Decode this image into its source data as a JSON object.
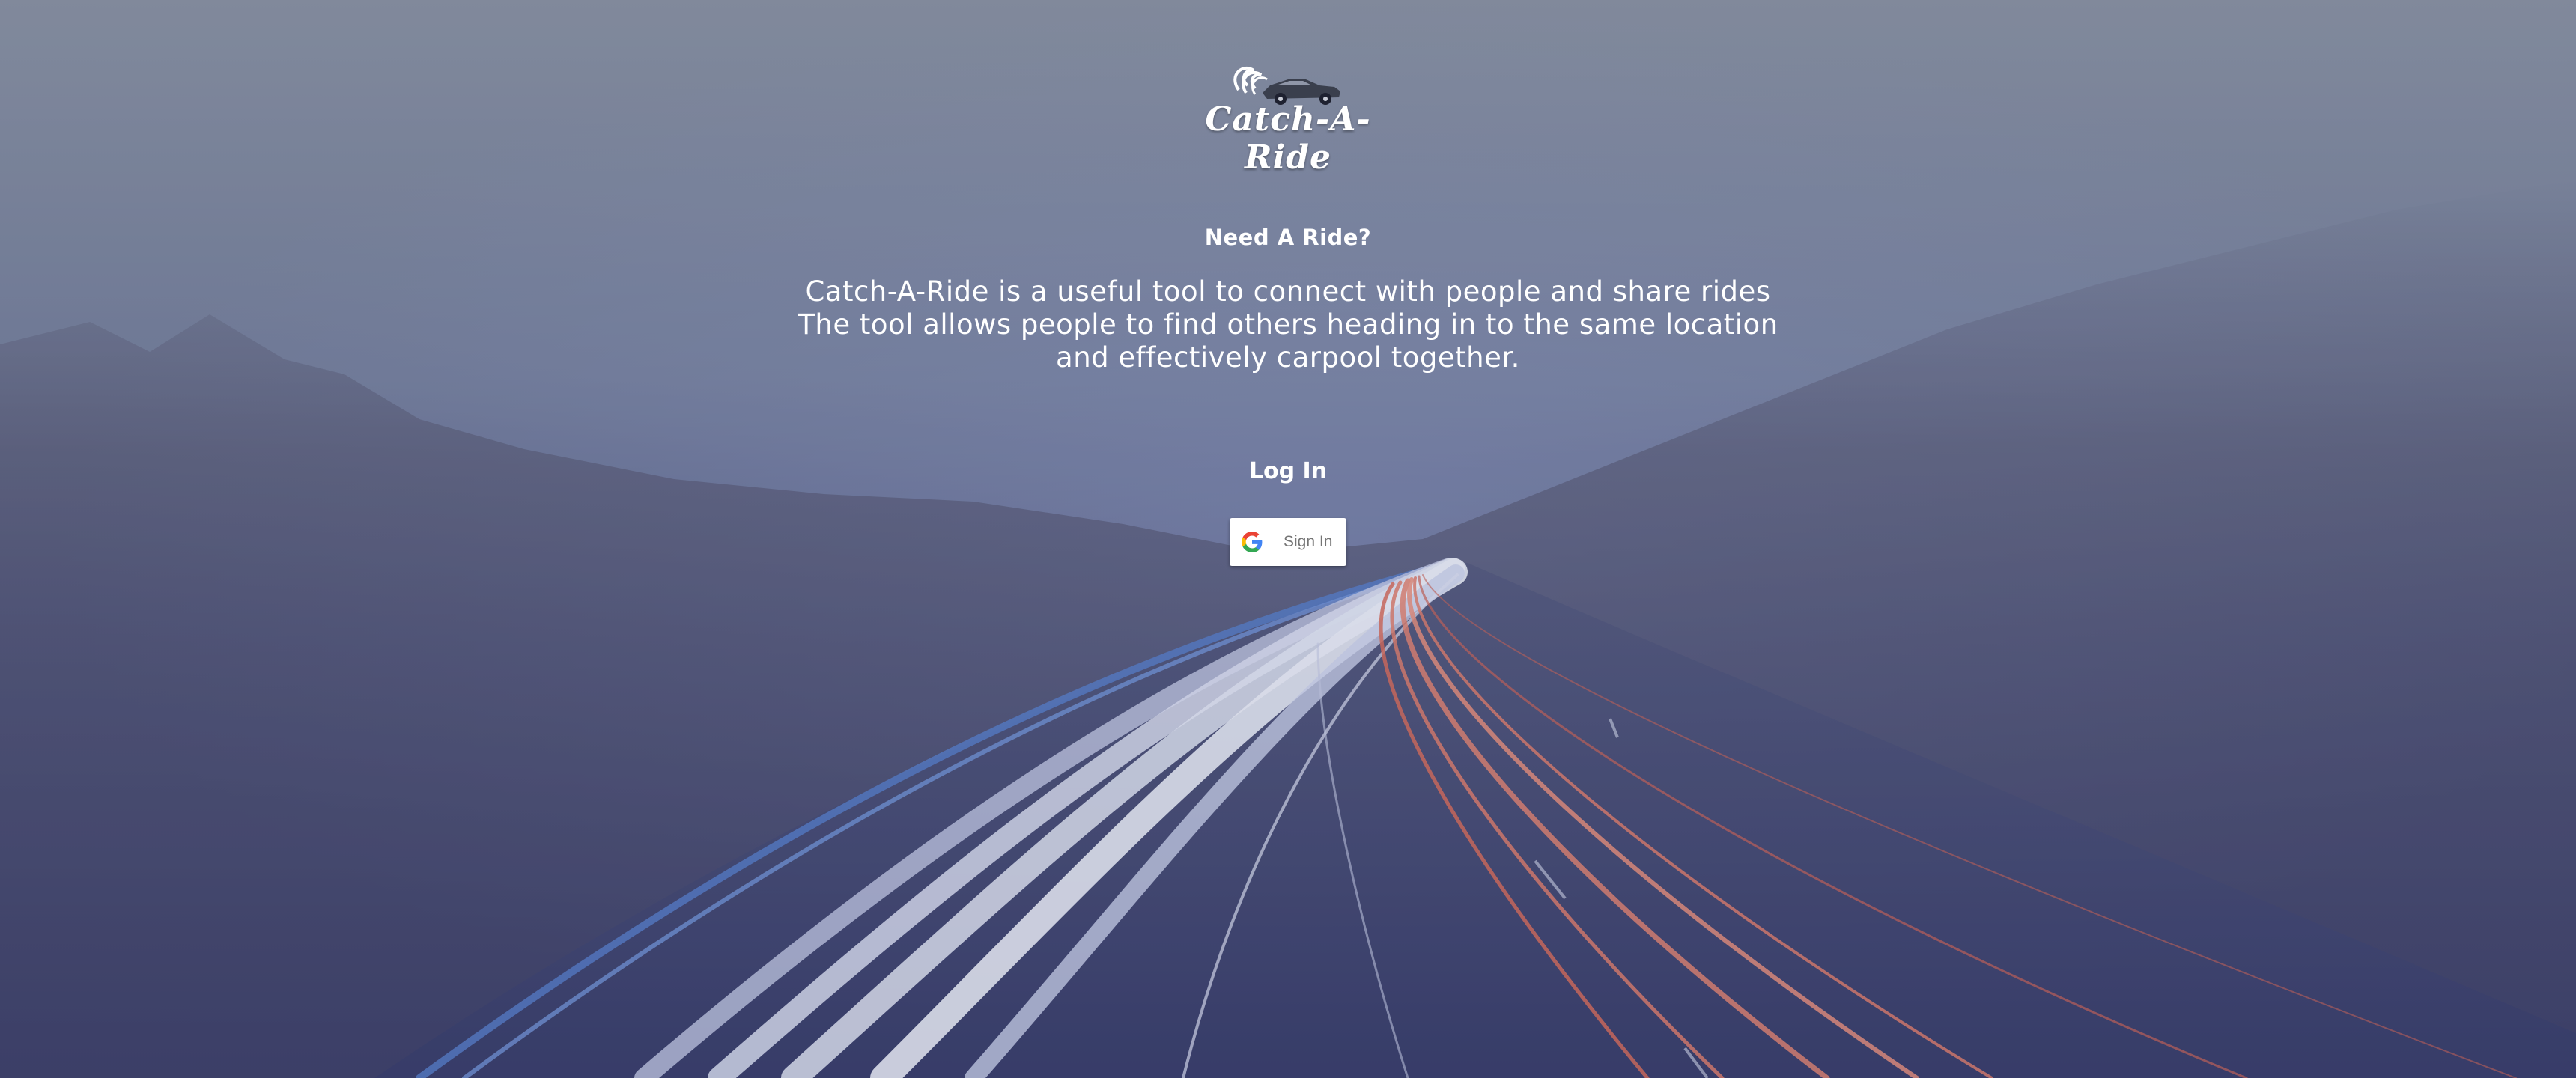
{
  "logo": {
    "text": "Catch-A-Ride",
    "icon": "car-logo-icon"
  },
  "hero": {
    "subtitle": "Need A Ride?",
    "description": "Catch-A-Ride is a useful tool to connect with people and share rides The tool allows people to find others heading in to the same location and effectively carpool together."
  },
  "login": {
    "heading": "Log In",
    "google_button_label": "Sign In",
    "google_icon": "google-g-icon"
  },
  "colors": {
    "text": "#ffffff",
    "button_bg": "#ffffff",
    "button_text": "#757575",
    "light_trails_white": "#d9def0",
    "light_trails_red": "#e0705e"
  }
}
